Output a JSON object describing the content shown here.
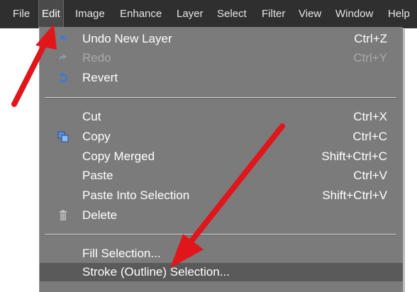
{
  "menubar": {
    "items": [
      "File",
      "Edit",
      "Image",
      "Enhance",
      "Layer",
      "Select",
      "Filter",
      "View",
      "Window",
      "Help"
    ]
  },
  "edit_menu": {
    "items": [
      {
        "label": "Undo New Layer",
        "shortcut": "Ctrl+Z",
        "icon": "undo-icon",
        "enabled": true
      },
      {
        "label": "Redo",
        "shortcut": "Ctrl+Y",
        "icon": "redo-icon",
        "enabled": false
      },
      {
        "label": "Revert",
        "shortcut": "",
        "icon": "revert-icon",
        "enabled": true
      },
      {
        "label": "Cut",
        "shortcut": "Ctrl+X",
        "icon": "",
        "enabled": true
      },
      {
        "label": "Copy",
        "shortcut": "Ctrl+C",
        "icon": "copy-icon",
        "enabled": true
      },
      {
        "label": "Copy Merged",
        "shortcut": "Shift+Ctrl+C",
        "icon": "",
        "enabled": true
      },
      {
        "label": "Paste",
        "shortcut": "Ctrl+V",
        "icon": "",
        "enabled": true
      },
      {
        "label": "Paste Into Selection",
        "shortcut": "Shift+Ctrl+V",
        "icon": "",
        "enabled": true
      },
      {
        "label": "Delete",
        "shortcut": "",
        "icon": "trash-icon",
        "enabled": true
      },
      {
        "label": "Fill Selection...",
        "shortcut": "",
        "icon": "",
        "enabled": true
      },
      {
        "label": "Stroke (Outline) Selection...",
        "shortcut": "",
        "icon": "",
        "enabled": true,
        "highlighted": true
      }
    ]
  },
  "colors": {
    "menubar_bg": "#2f2f2f",
    "menu_bg": "#7b7b7b",
    "highlight_bg": "#5a5a5a",
    "annotation_arrow": "#e0161b"
  },
  "annotations": [
    "red-arrow-to-edit-menu",
    "red-arrow-to-stroke-selection"
  ]
}
